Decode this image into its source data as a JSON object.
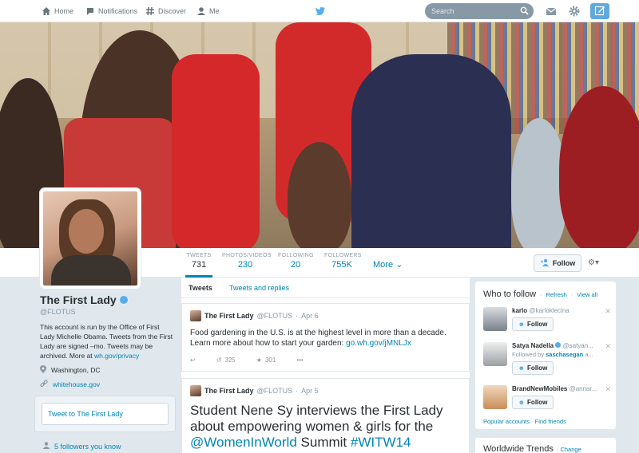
{
  "nav": {
    "home": "Home",
    "notifications": "Notifications",
    "discover": "Discover",
    "me": "Me",
    "search_placeholder": "Search"
  },
  "stats": [
    {
      "label": "TWEETS",
      "value": "731"
    },
    {
      "label": "PHOTOS/VIDEOS",
      "value": "230"
    },
    {
      "label": "FOLLOWING",
      "value": "20"
    },
    {
      "label": "FOLLOWERS",
      "value": "755K"
    }
  ],
  "more_label": "More",
  "follow_label": "Follow",
  "profile": {
    "name": "The First Lady",
    "handle": "@FLOTUS",
    "bio_text": "This account is run by the Office of First Lady Michelle Obama. Tweets from the First Lady are signed –mo. Tweets may be archived. More at ",
    "bio_link": "wh.gov/privacy",
    "location": "Washington, DC",
    "website": "whitehouse.gov",
    "tweet_to": "Tweet to The First Lady",
    "followers_you_know": "5 followers you know"
  },
  "timeline": {
    "tab_tweets": "Tweets",
    "tab_replies": "Tweets and replies",
    "tweets": [
      {
        "name": "The First Lady",
        "handle": "@FLOTUS",
        "date": "Apr 6",
        "text": "Food gardening in the U.S. is at the highest level in more than a decade. Learn more about how to start your garden: ",
        "link": "go.wh.gov/jMNLJx",
        "retweets": "325",
        "favorites": "301"
      },
      {
        "name": "The First Lady",
        "handle": "@FLOTUS",
        "date": "Apr 5",
        "text_1": "Student Nene Sy interviews the First Lady about empowering women & girls for the ",
        "mention": "@WomenInWorld",
        "text_2": " Summit ",
        "hashtag": "#WITW14"
      }
    ]
  },
  "who_to_follow": {
    "title": "Who to follow",
    "refresh": "Refresh",
    "view_all": "View all",
    "users": [
      {
        "name": "karlo",
        "handle": "@karloklecina",
        "sub": ""
      },
      {
        "name": "Satya Nadella",
        "handle": "@satyan...",
        "sub_prefix": "Followed by ",
        "sub_link": "saschasegan",
        "sub_suffix": " a..."
      },
      {
        "name": "BrandNewMobiles",
        "handle": "@annar...",
        "sub": ""
      }
    ],
    "popular": "Popular accounts",
    "find_friends": "Find friends"
  },
  "trends": {
    "title": "Worldwide Trends",
    "change": "Change"
  },
  "colors": {
    "accent": "#0084b4",
    "twitter_blue": "#55acee",
    "compose": "#5ea9dd"
  }
}
